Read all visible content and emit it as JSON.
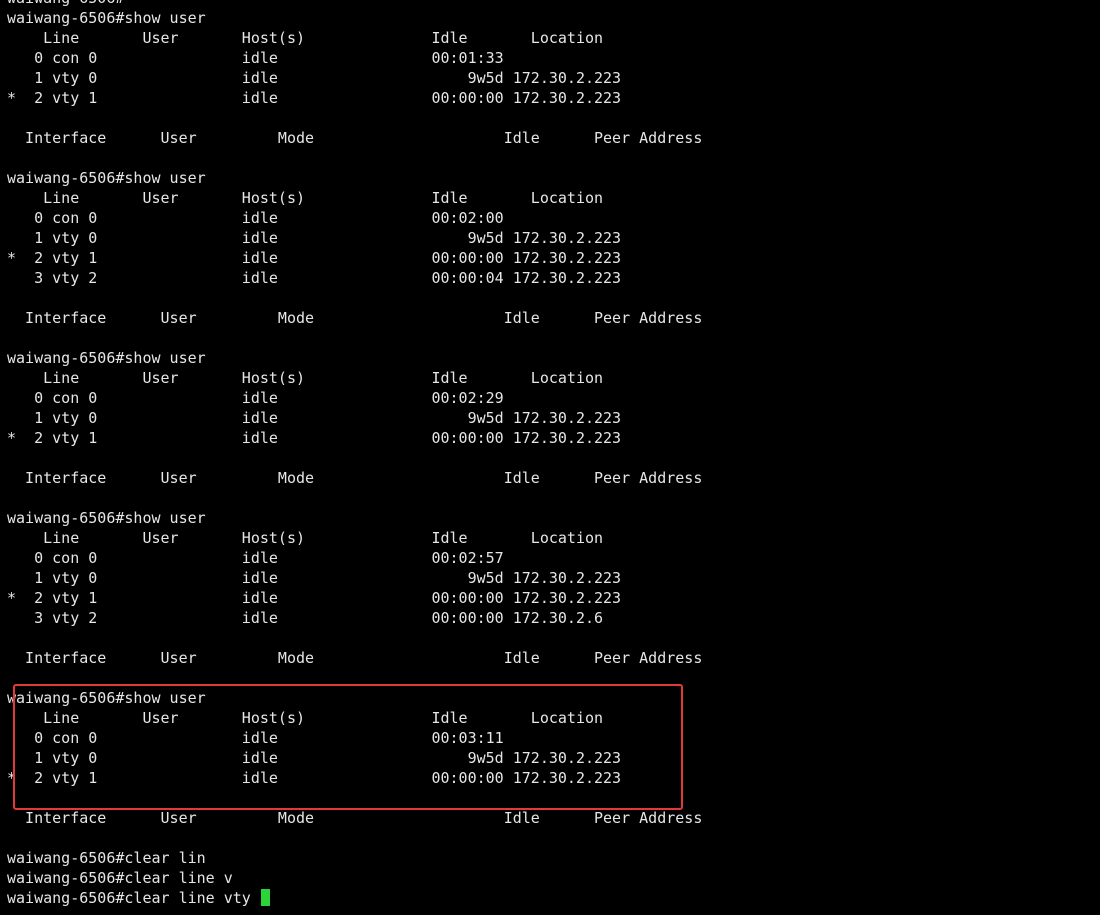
{
  "terminal": {
    "cursor_color": "#2bd43a",
    "highlight_color": "#e23a3a",
    "lines": [
      "waiwang-6506#",
      "waiwang-6506#show user",
      "    Line       User       Host(s)              Idle       Location",
      "   0 con 0                idle                 00:01:33",
      "   1 vty 0                idle                     9w5d 172.30.2.223",
      "*  2 vty 1                idle                 00:00:00 172.30.2.223",
      "",
      "  Interface      User         Mode                     Idle      Peer Address",
      "",
      "waiwang-6506#show user",
      "    Line       User       Host(s)              Idle       Location",
      "   0 con 0                idle                 00:02:00",
      "   1 vty 0                idle                     9w5d 172.30.2.223",
      "*  2 vty 1                idle                 00:00:00 172.30.2.223",
      "   3 vty 2                idle                 00:00:04 172.30.2.223",
      "",
      "  Interface      User         Mode                     Idle      Peer Address",
      "",
      "waiwang-6506#show user",
      "    Line       User       Host(s)              Idle       Location",
      "   0 con 0                idle                 00:02:29",
      "   1 vty 0                idle                     9w5d 172.30.2.223",
      "*  2 vty 1                idle                 00:00:00 172.30.2.223",
      "",
      "  Interface      User         Mode                     Idle      Peer Address",
      "",
      "waiwang-6506#show user",
      "    Line       User       Host(s)              Idle       Location",
      "   0 con 0                idle                 00:02:57",
      "   1 vty 0                idle                     9w5d 172.30.2.223",
      "*  2 vty 1                idle                 00:00:00 172.30.2.223",
      "   3 vty 2                idle                 00:00:00 172.30.2.6",
      "",
      "  Interface      User         Mode                     Idle      Peer Address",
      "",
      "waiwang-6506#show user",
      "    Line       User       Host(s)              Idle       Location",
      "   0 con 0                idle                 00:03:11",
      "   1 vty 0                idle                     9w5d 172.30.2.223",
      "*  2 vty 1                idle                 00:00:00 172.30.2.223",
      "",
      "  Interface      User         Mode                     Idle      Peer Address",
      "",
      "waiwang-6506#clear lin",
      "waiwang-6506#clear line v",
      "waiwang-6506#clear line vty "
    ]
  }
}
